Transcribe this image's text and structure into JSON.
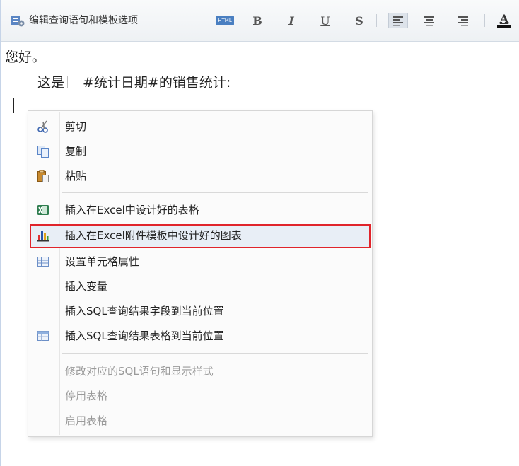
{
  "toolbar": {
    "edit_label": "编辑查询语句和模板选项",
    "html_label": "HTML",
    "bold_label": "B",
    "italic_label": "I",
    "underline_label": "U",
    "strike_label": "S",
    "font_color_label": "A"
  },
  "content": {
    "greeting": "您好。",
    "line2_prefix": "这是",
    "line2_rest": "#统计日期#的销售统计:"
  },
  "context_menu": {
    "items": [
      {
        "label": "剪切",
        "icon": "scissors-icon",
        "enabled": true
      },
      {
        "label": "复制",
        "icon": "copy-icon",
        "enabled": true
      },
      {
        "label": "粘贴",
        "icon": "paste-icon",
        "enabled": true
      },
      {
        "label": "插入在Excel中设计好的表格",
        "icon": "excel-icon",
        "enabled": true
      },
      {
        "label": "插入在Excel附件模板中设计好的图表",
        "icon": "chart-icon",
        "enabled": true,
        "highlighted": true
      },
      {
        "label": "设置单元格属性",
        "icon": "table-cell-icon",
        "enabled": true
      },
      {
        "label": "插入变量",
        "enabled": true
      },
      {
        "label": "插入SQL查询结果字段到当前位置",
        "enabled": true
      },
      {
        "label": "插入SQL查询结果表格到当前位置",
        "icon": "table-icon",
        "enabled": true
      },
      {
        "label": "修改对应的SQL语句和显示样式",
        "enabled": false
      },
      {
        "label": "停用表格",
        "enabled": false
      },
      {
        "label": "启用表格",
        "enabled": false
      }
    ]
  },
  "colors": {
    "highlight_border": "#e0242b",
    "highlight_bg": "#e8eef6",
    "disabled_text": "#9a9a9a"
  }
}
